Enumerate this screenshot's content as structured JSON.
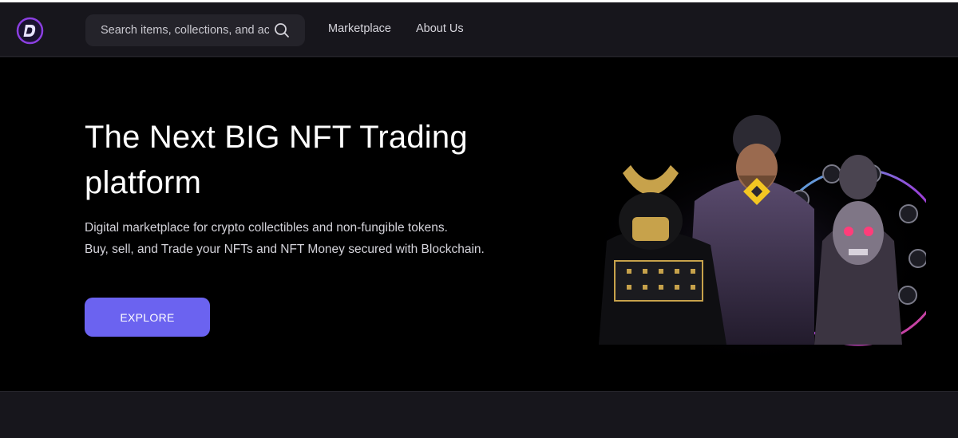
{
  "header": {
    "logo_letter": "D",
    "search": {
      "placeholder": "Search items, collections, and accounts"
    },
    "nav": [
      {
        "label": "Marketplace"
      },
      {
        "label": "About Us"
      }
    ]
  },
  "hero": {
    "title": "The Next BIG NFT Trading platform",
    "subtitle_lines": [
      "Digital marketplace for crypto collectibles and non-fungible tokens.",
      "Buy, sell, and Trade your NFTs and NFT Money secured with Blockchain."
    ],
    "cta_label": "EXPLORE"
  },
  "colors": {
    "page_bg": "#141318",
    "hero_bg": "#000000",
    "accent": "#6b63f0",
    "logo_ring": "#8b3fe0"
  },
  "icons": [
    "logo-icon",
    "search-icon",
    "hero-nft-characters-image"
  ]
}
